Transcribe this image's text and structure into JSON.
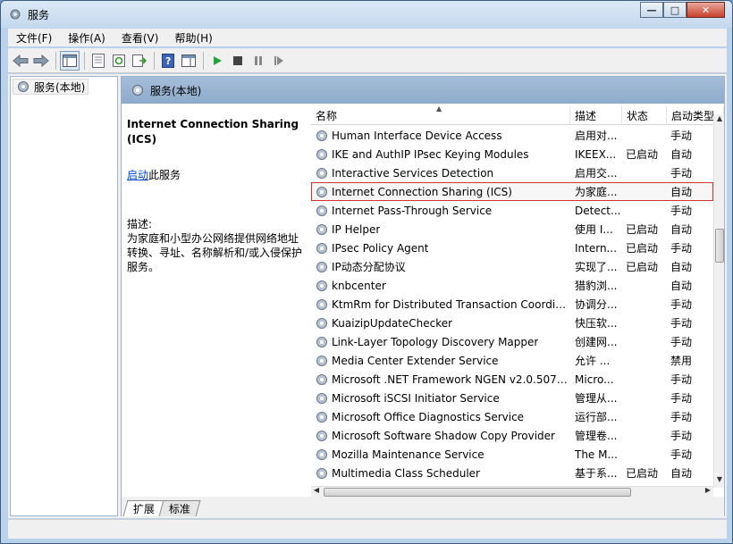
{
  "window": {
    "title": "服务"
  },
  "menu": [
    "文件(F)",
    "操作(A)",
    "查看(V)",
    "帮助(H)"
  ],
  "tree": {
    "item": "服务(本地)"
  },
  "content": {
    "header": "服务(本地)"
  },
  "description": {
    "title": "Internet Connection Sharing (ICS)",
    "action_link": "启动",
    "action_suffix": "此服务",
    "label": "描述:",
    "text": "为家庭和小型办公网络提供网络地址转换、寻址、名称解析和/或入侵保护服务。"
  },
  "columns": {
    "name": "名称",
    "desc": "描述",
    "status": "状态",
    "startup": "启动类型"
  },
  "rows": [
    {
      "name": "Human Interface Device Access",
      "desc": "启用对...",
      "status": "",
      "startup": "手动"
    },
    {
      "name": "IKE and AuthIP IPsec Keying Modules",
      "desc": "IKEEX...",
      "status": "已启动",
      "startup": "自动"
    },
    {
      "name": "Interactive Services Detection",
      "desc": "启用交...",
      "status": "",
      "startup": "手动"
    },
    {
      "name": "Internet Connection Sharing (ICS)",
      "desc": "为家庭...",
      "status": "",
      "startup": "自动"
    },
    {
      "name": "Internet Pass-Through Service",
      "desc": "Detect...",
      "status": "",
      "startup": "手动"
    },
    {
      "name": "IP Helper",
      "desc": "使用 I...",
      "status": "已启动",
      "startup": "自动"
    },
    {
      "name": "IPsec Policy Agent",
      "desc": "Intern...",
      "status": "已启动",
      "startup": "手动"
    },
    {
      "name": "IP动态分配协议",
      "desc": "实现了...",
      "status": "已启动",
      "startup": "自动"
    },
    {
      "name": "knbcenter",
      "desc": "猎豹浏...",
      "status": "",
      "startup": "自动"
    },
    {
      "name": "KtmRm for Distributed Transaction Coordin...",
      "desc": "协调分...",
      "status": "",
      "startup": "手动"
    },
    {
      "name": "KuaizipUpdateChecker",
      "desc": "快压软...",
      "status": "",
      "startup": "手动"
    },
    {
      "name": "Link-Layer Topology Discovery Mapper",
      "desc": "创建网...",
      "status": "",
      "startup": "手动"
    },
    {
      "name": "Media Center Extender Service",
      "desc": "允许 ...",
      "status": "",
      "startup": "禁用"
    },
    {
      "name": "Microsoft .NET Framework NGEN v2.0.5072...",
      "desc": "Micro...",
      "status": "",
      "startup": "手动"
    },
    {
      "name": "Microsoft iSCSI Initiator Service",
      "desc": "管理从...",
      "status": "",
      "startup": "手动"
    },
    {
      "name": "Microsoft Office Diagnostics Service",
      "desc": "运行部...",
      "status": "",
      "startup": "手动"
    },
    {
      "name": "Microsoft Software Shadow Copy Provider",
      "desc": "管理卷...",
      "status": "",
      "startup": "手动"
    },
    {
      "name": "Mozilla Maintenance Service",
      "desc": "The M...",
      "status": "",
      "startup": "手动"
    },
    {
      "name": "Multimedia Class Scheduler",
      "desc": "基于系...",
      "status": "已启动",
      "startup": "自动"
    }
  ],
  "tabs": [
    "扩展",
    "标准"
  ],
  "colors": {
    "selection_outline": "#d23232",
    "header_band": "#9ab4d3",
    "link": "#0046d5"
  }
}
